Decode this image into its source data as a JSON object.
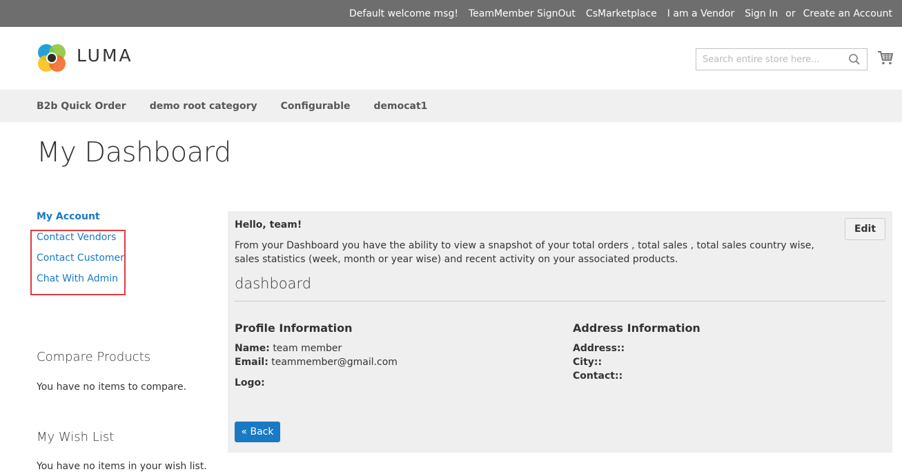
{
  "top_links": [
    "Default welcome msg!",
    "TeamMember SignOut",
    "CsMarketplace",
    "I am a Vendor",
    "Sign In",
    "or",
    "Create an Account"
  ],
  "header": {
    "logo_text": "LUMA",
    "search_placeholder": "Search entire store here...",
    "search_icon": "search-icon",
    "cart_icon": "cart-icon"
  },
  "nav": [
    "B2b Quick Order",
    "demo root category",
    "Configurable",
    "democat1"
  ],
  "page_title": "My Dashboard",
  "sidebar": {
    "my_account": "My Account",
    "links": [
      "Contact Vendors",
      "Contact Customer",
      "Chat With Admin"
    ],
    "compare_title": "Compare Products",
    "compare_text": "You have no items to compare.",
    "wishlist_title": "My Wish List",
    "wishlist_text": "You have no items in your wish list."
  },
  "main": {
    "hello": "Hello, team!",
    "intro": "From your Dashboard you have the ability to view a snapshot of your total orders , total sales , total sales country wise, sales statistics (week, month or year wise) and recent activity on your associated products.",
    "edit_label": "Edit",
    "section_title": "dashboard",
    "profile": {
      "title": "Profile Information",
      "name_label": "Name:",
      "name_value": "team member",
      "email_label": "Email:",
      "email_value": "teammember@gmail.com",
      "logo_label": "Logo:"
    },
    "address": {
      "title": "Address Information",
      "address_label": "Address::",
      "city_label": "City::",
      "contact_label": "Contact::"
    },
    "back_label": "« Back"
  },
  "colors": {
    "link": "#1979c3",
    "topbar": "#6e6e6e",
    "highlight_box": "#e0393e"
  }
}
